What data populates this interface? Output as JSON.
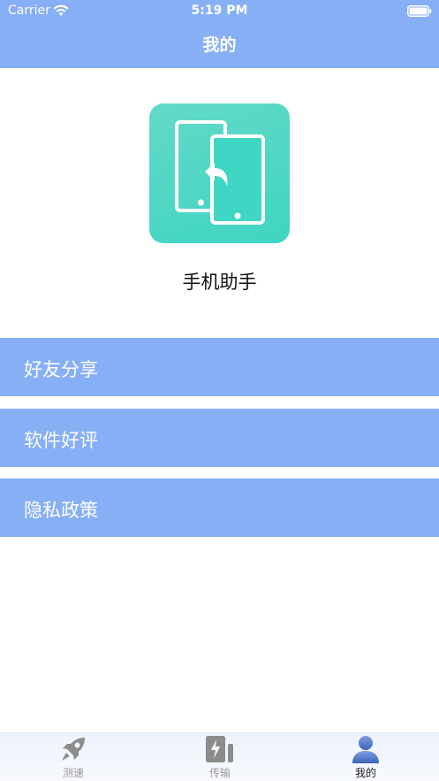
{
  "status_bar": {
    "carrier": "Carrier",
    "time": "5:19 PM",
    "wifi_icon": "wifi-icon",
    "battery_icon": "battery-icon"
  },
  "nav": {
    "title": "我的"
  },
  "profile": {
    "app_icon": "phone-transfer-icon",
    "app_name": "手机助手"
  },
  "menu": [
    {
      "label": "好友分享"
    },
    {
      "label": "软件好评"
    },
    {
      "label": "隐私政策"
    }
  ],
  "tabbar": {
    "tabs": [
      {
        "label": "测速",
        "icon": "rocket-icon"
      },
      {
        "label": "传输",
        "icon": "transfer-icon"
      },
      {
        "label": "我的",
        "icon": "user-icon",
        "active": true
      }
    ]
  },
  "colors": {
    "primary": "#86aff5",
    "app_icon_bg": "#3ed6c2",
    "tab_active": "#4b72c7",
    "tab_inactive": "#8c8c8c"
  }
}
